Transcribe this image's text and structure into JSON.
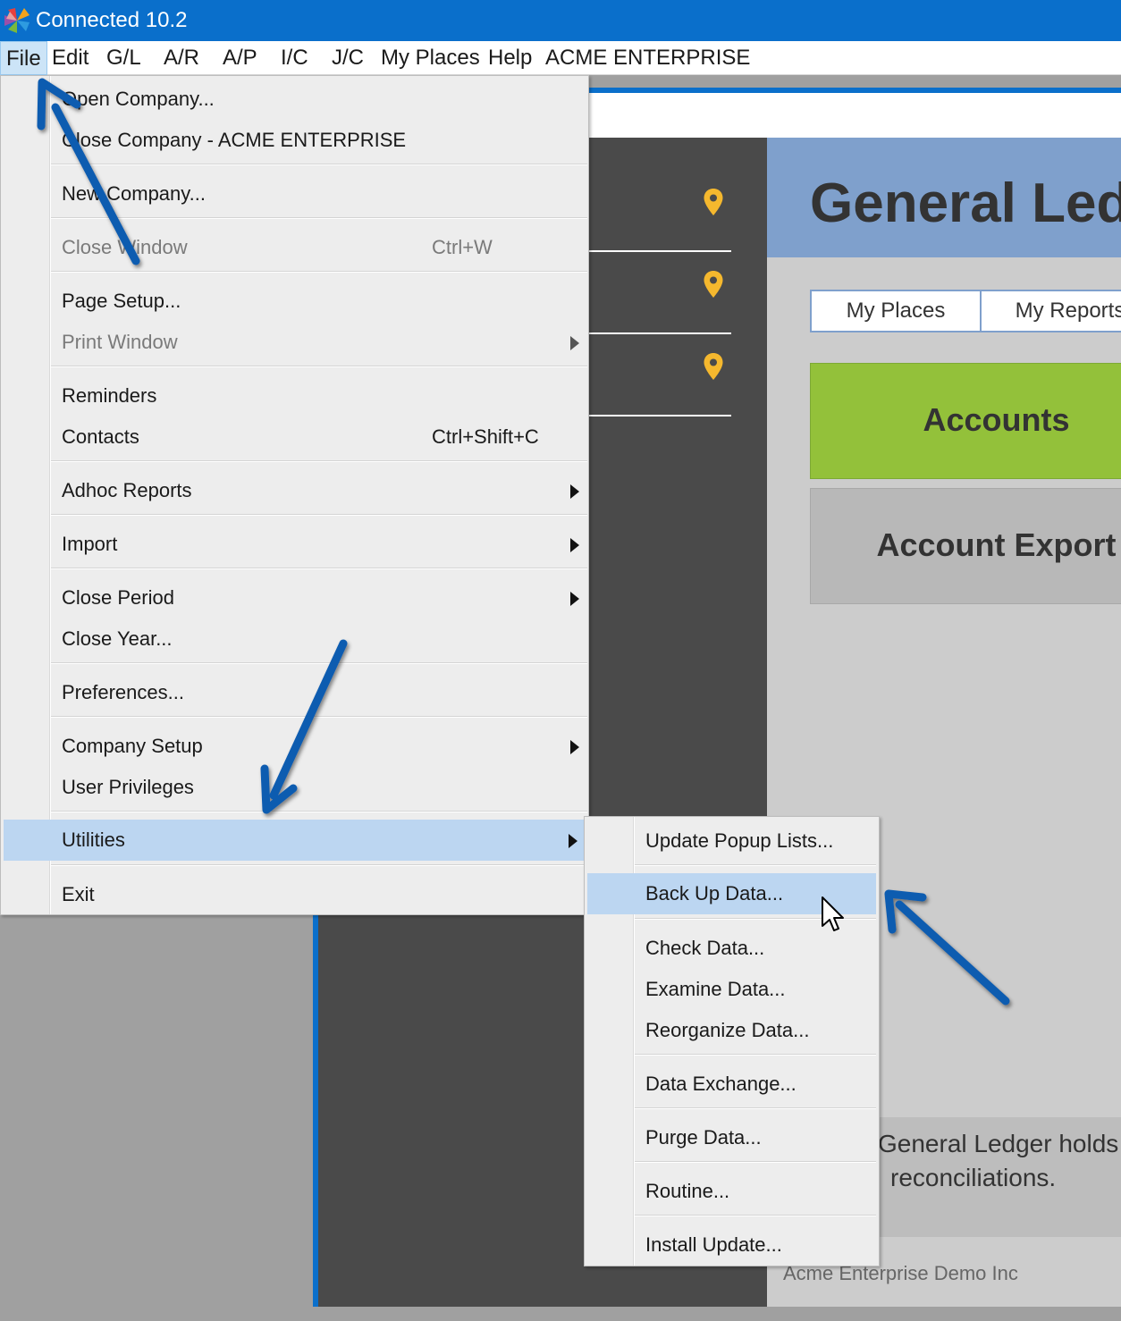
{
  "window": {
    "title": "Connected 10.2"
  },
  "menubar": {
    "items": [
      "File",
      "Edit",
      "G/L",
      "A/R",
      "A/P",
      "I/C",
      "J/C",
      "My Places",
      "Help",
      "ACME ENTERPRISE"
    ]
  },
  "file_menu": {
    "items": [
      {
        "label": "Open Company...",
        "shortcut": "",
        "enabled": true,
        "submenu": false
      },
      {
        "label": "Close Company - ACME ENTERPRISE",
        "shortcut": "",
        "enabled": true,
        "submenu": false
      },
      {
        "label": "New Company...",
        "shortcut": "",
        "enabled": true,
        "submenu": false
      },
      {
        "label": "Close Window",
        "shortcut": "Ctrl+W",
        "enabled": false,
        "submenu": false
      },
      {
        "label": "Page Setup...",
        "shortcut": "",
        "enabled": true,
        "submenu": false
      },
      {
        "label": "Print Window",
        "shortcut": "",
        "enabled": false,
        "submenu": true
      },
      {
        "label": "Reminders",
        "shortcut": "",
        "enabled": true,
        "submenu": false
      },
      {
        "label": "Contacts",
        "shortcut": "Ctrl+Shift+C",
        "enabled": true,
        "submenu": false
      },
      {
        "label": "Adhoc Reports",
        "shortcut": "",
        "enabled": true,
        "submenu": true
      },
      {
        "label": "Import",
        "shortcut": "",
        "enabled": true,
        "submenu": true
      },
      {
        "label": "Close Period",
        "shortcut": "",
        "enabled": true,
        "submenu": true
      },
      {
        "label": "Close Year...",
        "shortcut": "",
        "enabled": true,
        "submenu": false
      },
      {
        "label": "Preferences...",
        "shortcut": "",
        "enabled": true,
        "submenu": false
      },
      {
        "label": "Company Setup",
        "shortcut": "",
        "enabled": true,
        "submenu": true
      },
      {
        "label": "User Privileges",
        "shortcut": "",
        "enabled": true,
        "submenu": false
      },
      {
        "label": "Utilities",
        "shortcut": "",
        "enabled": true,
        "submenu": true,
        "highlighted": true
      },
      {
        "label": "Exit",
        "shortcut": "",
        "enabled": true,
        "submenu": false
      }
    ]
  },
  "utilities_menu": {
    "items": [
      {
        "label": "Update Popup Lists..."
      },
      {
        "label": "Back Up Data...",
        "highlighted": true
      },
      {
        "label": "Check Data..."
      },
      {
        "label": "Examine Data..."
      },
      {
        "label": "Reorganize Data..."
      },
      {
        "label": "Data Exchange..."
      },
      {
        "label": "Purge Data..."
      },
      {
        "label": "Routine..."
      },
      {
        "label": "Install Update..."
      }
    ]
  },
  "background": {
    "module_title": "General Ledg",
    "tabs": [
      "My Places",
      "My Reports"
    ],
    "tiles": [
      "Accounts",
      "Account Export"
    ],
    "description_lines": [
      "General Ledger holds",
      "reconciliations."
    ],
    "company_footer": "Acme Enterprise Demo Inc"
  },
  "colors": {
    "titlebar": "#0a6fcb",
    "menu_highlight": "#bcd6f1",
    "gl_header": "#7fa0cc",
    "accounts_tile": "#93c13a",
    "pin": "#f5b82e",
    "annotation_arrow": "#0f5bb0"
  },
  "icons": [
    "app-logo-icon",
    "location-pin-icon",
    "mouse-pointer-icon",
    "submenu-arrow-icon"
  ]
}
